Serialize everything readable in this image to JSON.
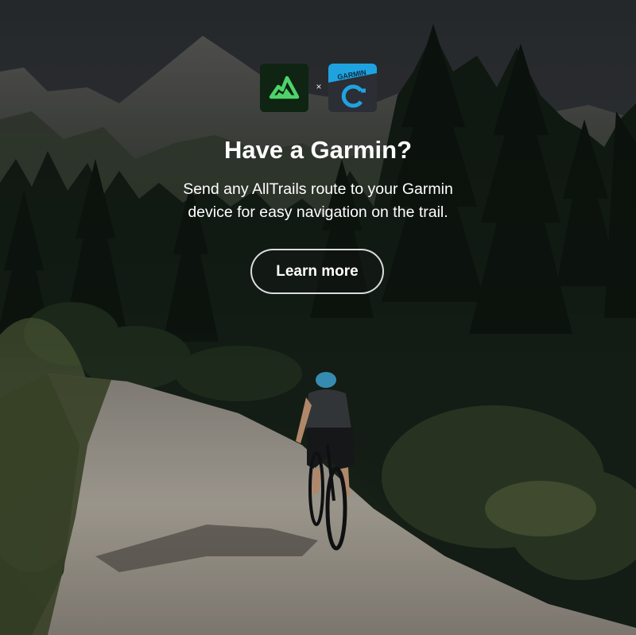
{
  "promo": {
    "title": "Have a Garmin?",
    "description": "Send any AllTrails route to your Garmin device for easy navigation on the trail.",
    "separator": "×",
    "cta_label": "Learn more",
    "partner_logo_text": "GARMIN"
  },
  "colors": {
    "alltrails_green": "#4ed36a",
    "garmin_blue": "#1fa3e0",
    "sky": "#3f4448",
    "forest": "#141c16",
    "path": "#a09a8f"
  },
  "icons": [
    "alltrails-logo-icon",
    "garmin-connect-logo-icon"
  ]
}
